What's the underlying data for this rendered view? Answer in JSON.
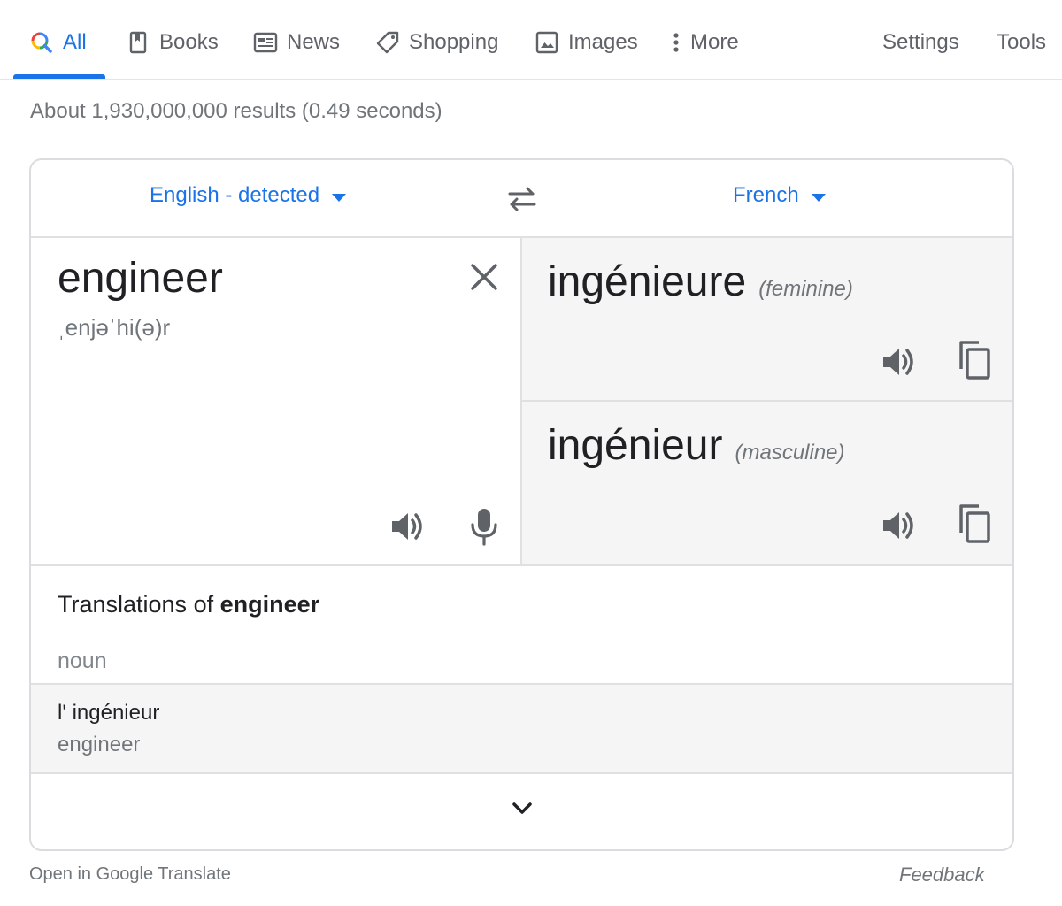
{
  "tabs": [
    {
      "label": "All",
      "icon": "search-icon",
      "active": true
    },
    {
      "label": "Books",
      "icon": "book-icon"
    },
    {
      "label": "News",
      "icon": "news-icon"
    },
    {
      "label": "Shopping",
      "icon": "tag-icon"
    },
    {
      "label": "Images",
      "icon": "image-icon"
    },
    {
      "label": "More",
      "icon": "more-vert-icon"
    },
    {
      "label": "Settings"
    },
    {
      "label": "Tools"
    }
  ],
  "stats": "About 1,930,000,000 results (0.49 seconds)",
  "translator": {
    "source_lang": "English - detected",
    "target_lang": "French",
    "source_text": "engineer",
    "source_phonetic": "ˌenjəˈhi(ə)r",
    "targets": [
      {
        "word": "ingénieure",
        "gender": "(feminine)"
      },
      {
        "word": "ingénieur",
        "gender": "(masculine)"
      }
    ],
    "translations_prefix": "Translations of ",
    "translations_term": "engineer",
    "part_of_speech": "noun",
    "entries": [
      {
        "word": "l' ingénieur",
        "back": "engineer"
      }
    ]
  },
  "footer": {
    "open_label": "Open in Google Translate",
    "feedback_label": "Feedback"
  },
  "colors": {
    "accent": "#1a73e8",
    "text": "#202124",
    "muted": "#70757a",
    "panel": "#f5f5f5",
    "border": "#dadce0"
  }
}
